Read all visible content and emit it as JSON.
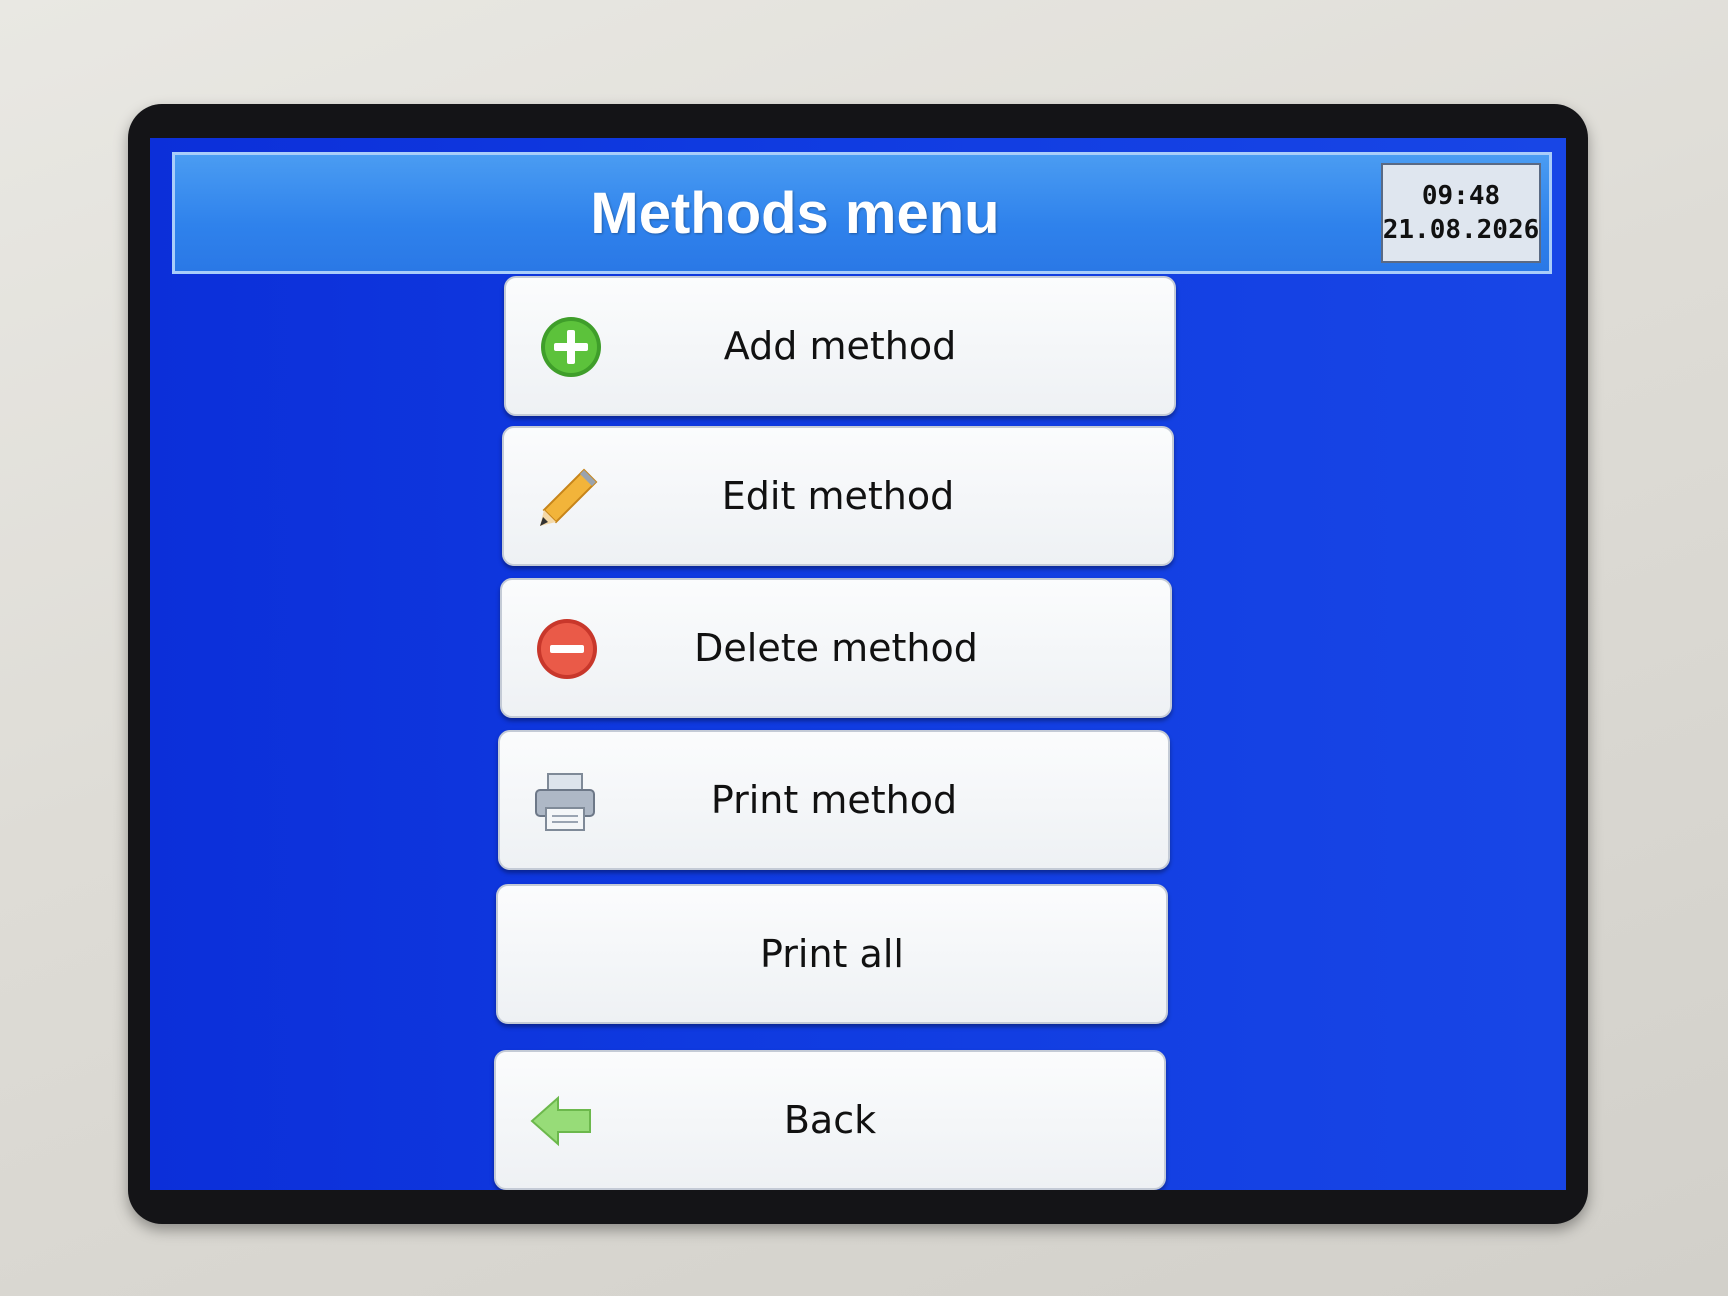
{
  "header": {
    "title": "Methods menu",
    "time": "09:48",
    "date": "21.08.2026"
  },
  "menu": {
    "add": {
      "label": "Add method",
      "icon": "plus-circle-icon"
    },
    "edit": {
      "label": "Edit method",
      "icon": "pencil-icon"
    },
    "delete": {
      "label": "Delete method",
      "icon": "minus-circle-icon"
    },
    "print": {
      "label": "Print method",
      "icon": "printer-icon"
    },
    "print_all": {
      "label": "Print all"
    },
    "back": {
      "label": "Back",
      "icon": "back-arrow-icon"
    }
  },
  "colors": {
    "screen_bg": "#0f3ae0",
    "header_bg": "#2f82ec",
    "button_bg": "#f3f5f7",
    "add_icon": "#4caf32",
    "delete_icon": "#e04a3c",
    "back_icon": "#8ed870"
  }
}
